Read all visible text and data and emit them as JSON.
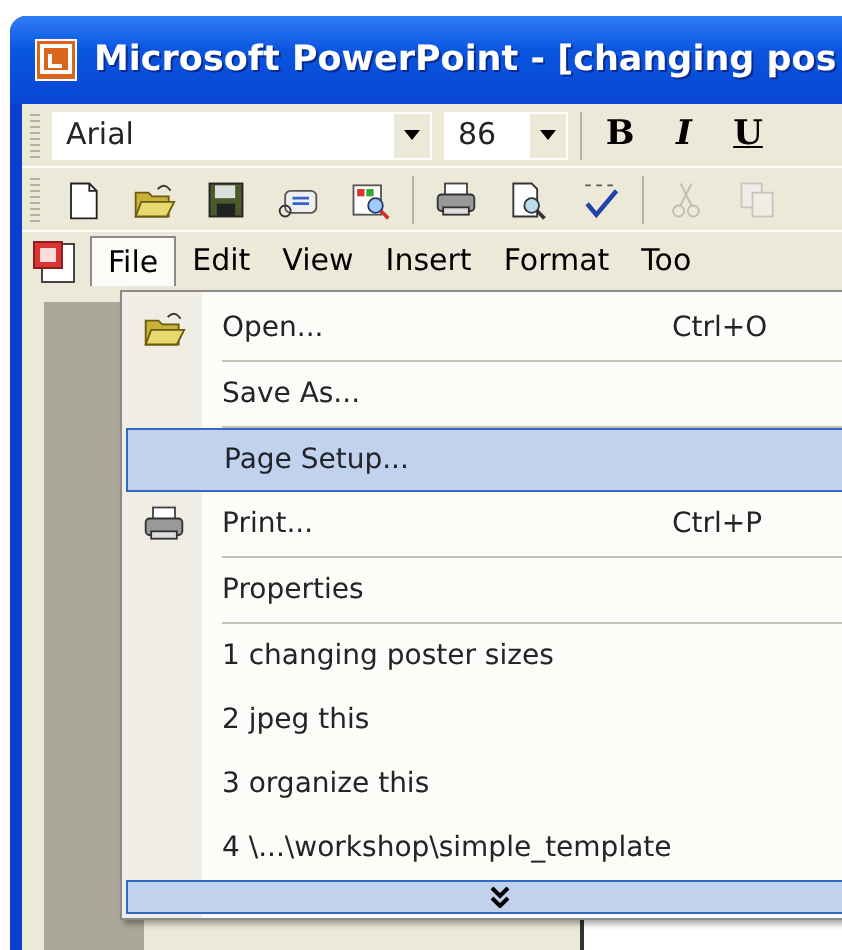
{
  "window": {
    "title": "Microsoft PowerPoint - [changing pos"
  },
  "formatting_toolbar": {
    "font": "Arial",
    "size": "86",
    "buttons": [
      {
        "label": "B",
        "kind": "bold"
      },
      {
        "label": "I",
        "kind": "italic"
      },
      {
        "label": "U",
        "kind": "underline"
      }
    ]
  },
  "standard_toolbar": [
    {
      "kind": "new",
      "disabled": false
    },
    {
      "kind": "open",
      "disabled": false
    },
    {
      "kind": "save",
      "disabled": false
    },
    {
      "kind": "email",
      "disabled": false
    },
    {
      "kind": "permission",
      "disabled": false
    },
    {
      "kind": "sep"
    },
    {
      "kind": "print",
      "disabled": false
    },
    {
      "kind": "preview",
      "disabled": false
    },
    {
      "kind": "spelling",
      "disabled": false
    },
    {
      "kind": "sep"
    },
    {
      "kind": "cut",
      "disabled": true
    },
    {
      "kind": "copy",
      "disabled": true
    }
  ],
  "menu_bar": [
    {
      "label": "File",
      "selected": true
    },
    {
      "label": "Edit",
      "selected": false
    },
    {
      "label": "View",
      "selected": false
    },
    {
      "label": "Insert",
      "selected": false
    },
    {
      "label": "Format",
      "selected": false
    },
    {
      "label": "Too",
      "selected": false
    }
  ],
  "file_menu": {
    "items": [
      {
        "label": "Open...",
        "shortcut": "Ctrl+O",
        "kind": "open",
        "selected": false,
        "separator_after": true
      },
      {
        "label": "Save As...",
        "selected": false,
        "separator_after": true
      },
      {
        "label": "Page Setup...",
        "selected": true,
        "separator_after": false
      },
      {
        "label": "Print...",
        "shortcut": "Ctrl+P",
        "kind": "print",
        "selected": false,
        "separator_after": true
      },
      {
        "label": "Properties",
        "selected": false,
        "separator_after": true
      },
      {
        "label": "1 changing poster sizes",
        "selected": false,
        "separator_after": false
      },
      {
        "label": "2 jpeg this",
        "selected": false,
        "separator_after": false
      },
      {
        "label": "3 organize this",
        "selected": false,
        "separator_after": false
      },
      {
        "label": "4 \\...\\workshop\\simple_template",
        "selected": false,
        "separator_after": false
      }
    ],
    "expand_bar": true
  }
}
